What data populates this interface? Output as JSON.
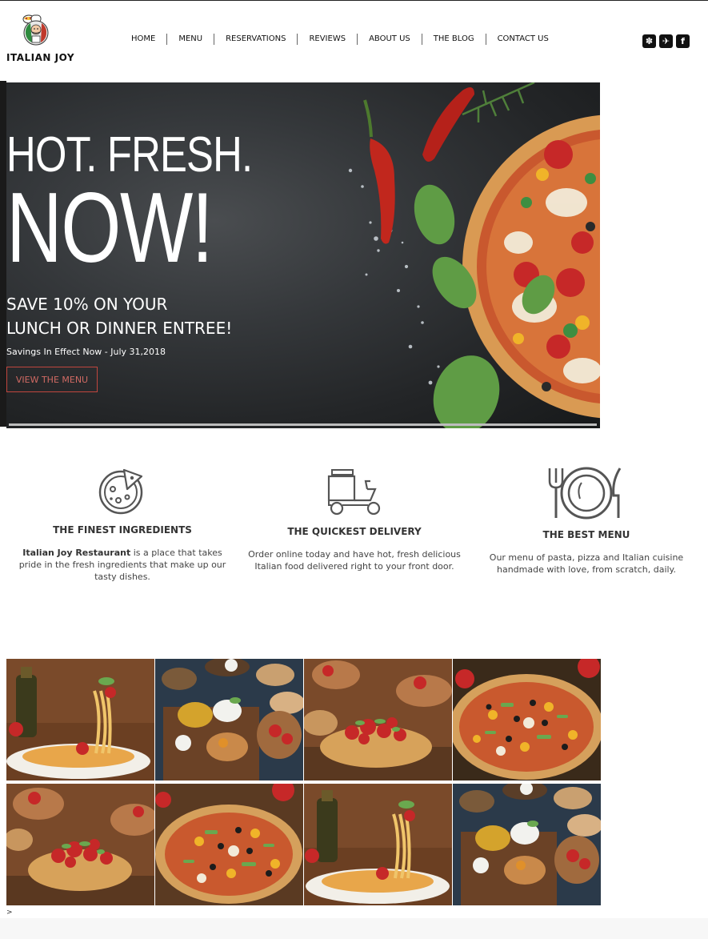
{
  "brand": {
    "name": "ITALIAN JOY"
  },
  "nav": {
    "items": [
      {
        "label": "HOME"
      },
      {
        "label": "MENU"
      },
      {
        "label": "RESERVATIONS"
      },
      {
        "label": "REVIEWS"
      },
      {
        "label": "ABOUT US"
      },
      {
        "label": "THE BLOG"
      },
      {
        "label": "CONTACT US"
      }
    ]
  },
  "social": {
    "items": [
      {
        "icon": "yelp-icon",
        "glyph": "✽"
      },
      {
        "icon": "twitter-icon",
        "glyph": "✈"
      },
      {
        "icon": "facebook-icon",
        "glyph": "f"
      }
    ]
  },
  "hero": {
    "title_line1": "HOT. FRESH.",
    "title_line2": "NOW!",
    "offer_line1": "SAVE 10% ON YOUR",
    "offer_line2": "LUNCH OR DINNER ENTREE!",
    "savings": "Savings In Effect Now - July 31,2018",
    "cta_label": "VIEW THE MENU",
    "accent_color": "#c0463e"
  },
  "features": [
    {
      "icon": "pizza-slice-icon",
      "title": "THE FINEST INGREDIENTS",
      "desc_bold": "Italian Joy Restaurant",
      "desc": " is a place that takes pride in the fresh ingredients that make up our tasty dishes."
    },
    {
      "icon": "delivery-scooter-icon",
      "title": "THE QUICKEST DELIVERY",
      "desc_bold": "",
      "desc": "Order online today and have hot, fresh delicious Italian food delivered right to your front door."
    },
    {
      "icon": "plate-cutlery-icon",
      "title": "THE BEST MENU",
      "desc_bold": "",
      "desc": "Our menu of pasta, pizza and Italian cuisine handmade with love, from scratch, daily."
    }
  ],
  "gallery": {
    "tiles": [
      {
        "kind": "spaghetti"
      },
      {
        "kind": "antipasti"
      },
      {
        "kind": "bruschetta"
      },
      {
        "kind": "pizza"
      },
      {
        "kind": "bruschetta"
      },
      {
        "kind": "pizza"
      },
      {
        "kind": "spaghetti"
      },
      {
        "kind": "antipasti"
      }
    ]
  },
  "footer": {
    "mark": ">"
  }
}
